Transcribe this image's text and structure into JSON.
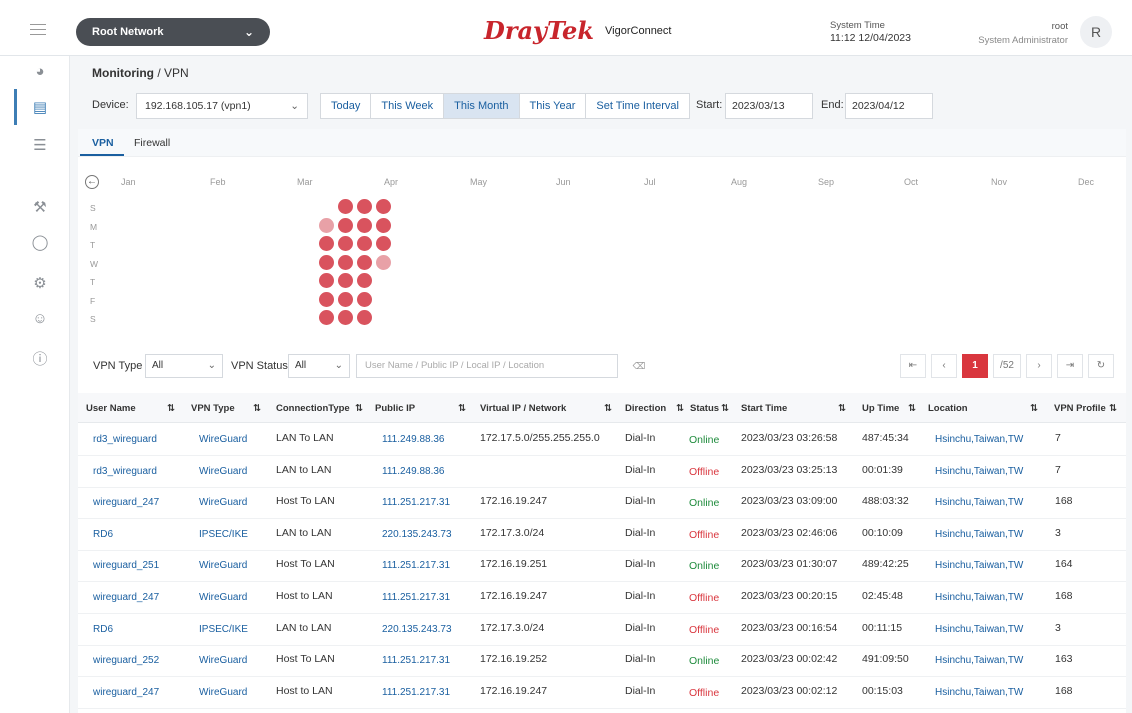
{
  "header": {
    "network_label": "Root Network",
    "brand_name": "DrayTek",
    "product_name": "VigorConnect",
    "system_time_label": "System Time",
    "system_time_value": "11:12 12/04/2023",
    "user_name": "root",
    "user_role": "System Administrator",
    "avatar_letter": "R"
  },
  "breadcrumb": {
    "section": "Monitoring",
    "separator": "/",
    "page": "VPN"
  },
  "toolbar": {
    "device_label": "Device:",
    "device_value": "192.168.105.17 (vpn1)",
    "ranges": [
      "Today",
      "This Week",
      "This Month",
      "This Year",
      "Set Time Interval"
    ],
    "active_range": "This Month",
    "start_label": "Start:",
    "start_value": "2023/03/13",
    "end_label": "End:",
    "end_value": "2023/04/12"
  },
  "tabs": [
    "VPN",
    "Firewall"
  ],
  "calendar": {
    "months": [
      "Jan",
      "Feb",
      "Mar",
      "Apr",
      "May",
      "Jun",
      "Jul",
      "Aug",
      "Sep",
      "Oct",
      "Nov",
      "Dec"
    ],
    "weekdays": [
      "S",
      "M",
      "T",
      "W",
      "T",
      "F",
      "S"
    ]
  },
  "filters": {
    "vpn_type_label": "VPN Type",
    "vpn_type_value": "All",
    "vpn_status_label": "VPN Status",
    "vpn_status_value": "All",
    "search_placeholder": "User Name / Public IP / Local IP / Location"
  },
  "pagination": {
    "current": "1",
    "total": "/52"
  },
  "table": {
    "columns": [
      "User Name",
      "VPN Type",
      "ConnectionType",
      "Public IP",
      "Virtual IP / Network",
      "Direction",
      "Status",
      "Start Time",
      "Up Time",
      "Location",
      "VPN Profile"
    ],
    "rows": [
      [
        "rd3_wireguard",
        "WireGuard",
        "LAN To LAN",
        "111.249.88.36",
        "172.17.5.0/255.255.255.0",
        "Dial-In",
        "Online",
        "2023/03/23 03:26:58",
        "487:45:34",
        "Hsinchu,Taiwan,TW",
        "7"
      ],
      [
        "rd3_wireguard",
        "WireGuard",
        "LAN to LAN",
        "111.249.88.36",
        "",
        "Dial-In",
        "Offline",
        "2023/03/23 03:25:13",
        "00:01:39",
        "Hsinchu,Taiwan,TW",
        "7"
      ],
      [
        "wireguard_247",
        "WireGuard",
        "Host To LAN",
        "111.251.217.31",
        "172.16.19.247",
        "Dial-In",
        "Online",
        "2023/03/23 03:09:00",
        "488:03:32",
        "Hsinchu,Taiwan,TW",
        "168"
      ],
      [
        "RD6",
        "IPSEC/IKE",
        "LAN to LAN",
        "220.135.243.73",
        "172.17.3.0/24",
        "Dial-In",
        "Offline",
        "2023/03/23 02:46:06",
        "00:10:09",
        "Hsinchu,Taiwan,TW",
        "3"
      ],
      [
        "wireguard_251",
        "WireGuard",
        "Host To LAN",
        "111.251.217.31",
        "172.16.19.251",
        "Dial-In",
        "Online",
        "2023/03/23 01:30:07",
        "489:42:25",
        "Hsinchu,Taiwan,TW",
        "164"
      ],
      [
        "wireguard_247",
        "WireGuard",
        "Host to LAN",
        "111.251.217.31",
        "172.16.19.247",
        "Dial-In",
        "Offline",
        "2023/03/23 00:20:15",
        "02:45:48",
        "Hsinchu,Taiwan,TW",
        "168"
      ],
      [
        "RD6",
        "IPSEC/IKE",
        "LAN to LAN",
        "220.135.243.73",
        "172.17.3.0/24",
        "Dial-In",
        "Offline",
        "2023/03/23 00:16:54",
        "00:11:15",
        "Hsinchu,Taiwan,TW",
        "3"
      ],
      [
        "wireguard_252",
        "WireGuard",
        "Host To LAN",
        "111.251.217.31",
        "172.16.19.252",
        "Dial-In",
        "Online",
        "2023/03/23 00:02:42",
        "491:09:50",
        "Hsinchu,Taiwan,TW",
        "163"
      ],
      [
        "wireguard_247",
        "WireGuard",
        "Host to LAN",
        "111.251.217.31",
        "172.16.19.247",
        "Dial-In",
        "Offline",
        "2023/03/23 00:02:12",
        "00:15:03",
        "Hsinchu,Taiwan,TW",
        "168"
      ]
    ]
  },
  "colors": {
    "brand_red": "#c8252c",
    "link_blue": "#1a5fa0",
    "online_green": "#1e8b3c",
    "offline_red": "#d9363e",
    "heat_strong": "#d9535e",
    "heat_light": "#e8a1a7"
  }
}
